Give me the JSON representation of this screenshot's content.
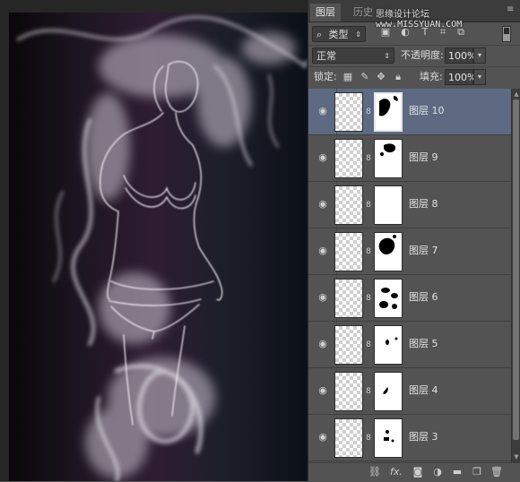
{
  "panel": {
    "tabs": [
      {
        "label": "图层"
      },
      {
        "label": "历史"
      }
    ],
    "watermark": "思缘设计论坛 www.MISSYUAN.COM",
    "filter": {
      "kind_label": "类型"
    },
    "blend_mode": "正常",
    "opacity": {
      "label": "不透明度:",
      "value": "100%"
    },
    "lock_label": "锁定:",
    "fill": {
      "label": "填充:",
      "value": "100%"
    },
    "layers": [
      {
        "name": "图层 10",
        "selected": true
      },
      {
        "name": "图层 9",
        "selected": false
      },
      {
        "name": "图层 8",
        "selected": false
      },
      {
        "name": "图层 7",
        "selected": false
      },
      {
        "name": "图层 6",
        "selected": false
      },
      {
        "name": "图层 5",
        "selected": false
      },
      {
        "name": "图层 4",
        "selected": false
      },
      {
        "name": "图层 3",
        "selected": false
      }
    ],
    "footer": {
      "fx_label": "fx."
    }
  },
  "icons": {
    "search": "search-icon",
    "eye": "eye-icon",
    "link": "chain-link-icon"
  }
}
